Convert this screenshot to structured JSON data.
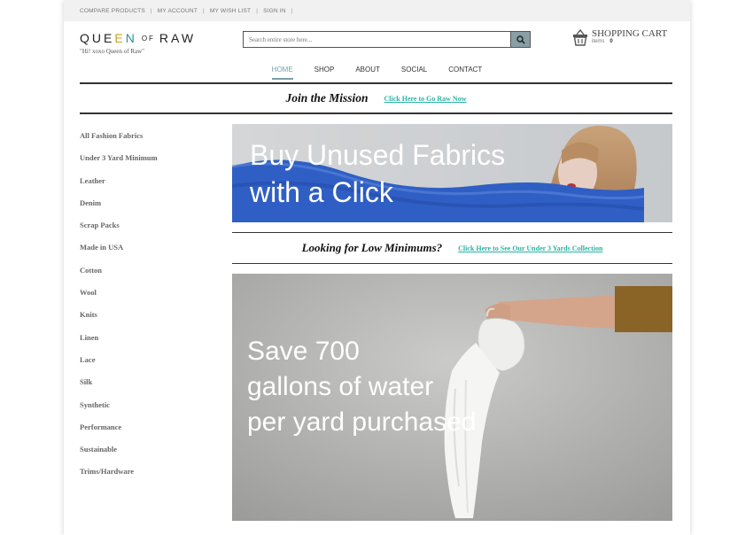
{
  "topbar": {
    "links": [
      "COMPARE PRODUCTS",
      "MY ACCOUNT",
      "MY WISH LIST",
      "SIGN IN"
    ]
  },
  "header": {
    "logo_left": "QUEEN",
    "logo_mid": "OF",
    "logo_right": "RAW",
    "tagline": "\"Hi! xoxo Queen of Raw\"",
    "search_placeholder": "Search entire store here...",
    "cart_title": "SHOPPING CART",
    "cart_items_label": "items",
    "cart_count": "0"
  },
  "nav": {
    "items": [
      "HOME",
      "SHOP",
      "ABOUT",
      "SOCIAL",
      "CONTACT"
    ],
    "active": "HOME"
  },
  "mission": {
    "title": "Join the Mission",
    "link": "Click Here to Go Raw Now"
  },
  "sidebar": {
    "items": [
      "All Fashion Fabrics",
      "Under 3 Yard Minimum",
      "Leather",
      "Denim",
      "Scrap Packs",
      "Made in USA",
      "Cotton",
      "Wool",
      "Knits",
      "Linen",
      "Lace",
      "Silk",
      "Synthetic",
      "Performance",
      "Sustainable",
      "Trims/Hardware"
    ]
  },
  "hero1": {
    "line1": "Buy Unused Fabrics",
    "line2": "with a Click"
  },
  "lowmin": {
    "title": "Looking for Low Minimums?",
    "link": "Click Here to See Our Under 3 Yards Collection"
  },
  "hero2": {
    "line1": "Save 700",
    "line2": "gallons of water",
    "line3": "per yard purchased"
  },
  "colors": {
    "accent": "#7a9fa8",
    "link": "#2ab3a3",
    "fabric_blue": "#2f5fc4"
  }
}
